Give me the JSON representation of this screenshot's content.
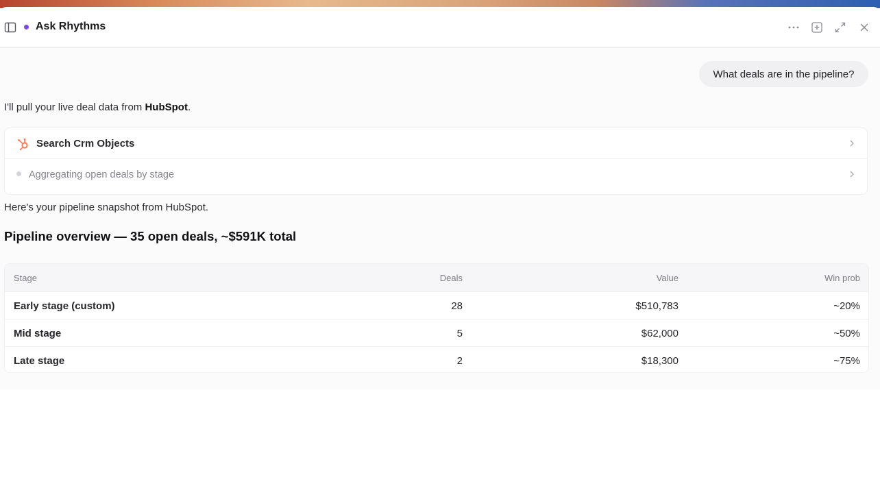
{
  "header": {
    "title": "Ask Rhythms",
    "icons": [
      "sidebar-toggle-icon",
      "more-icon",
      "new-chat-icon",
      "expand-icon",
      "close-icon"
    ]
  },
  "chat": {
    "user_message": "What deals are in the pipeline?",
    "intro": {
      "prefix": "I'll pull your live deal data from ",
      "brand": "HubSpot",
      "suffix": "."
    },
    "tool_call": {
      "label": "Search Crm Objects",
      "icon": "hubspot-icon"
    },
    "step": {
      "label": "Aggregating open deals by stage"
    },
    "summary": "Here's your pipeline snapshot from HubSpot.",
    "heading": "Pipeline overview — 35 open deals, ~$591K total"
  },
  "table": {
    "headers": {
      "stage": "Stage",
      "deals": "Deals",
      "value": "Value",
      "win_prob": "Win prob"
    },
    "rows": [
      {
        "stage": "Early stage (custom)",
        "deals": "28",
        "value": "$510,783",
        "win_prob": "~20%"
      },
      {
        "stage": "Mid stage",
        "deals": "5",
        "value": "$62,000",
        "win_prob": "~50%"
      },
      {
        "stage": "Late stage",
        "deals": "2",
        "value": "$18,300",
        "win_prob": "~75%"
      }
    ]
  },
  "colors": {
    "status_dot": "#7a4be0",
    "hubspot_orange": "#ff7a59"
  }
}
